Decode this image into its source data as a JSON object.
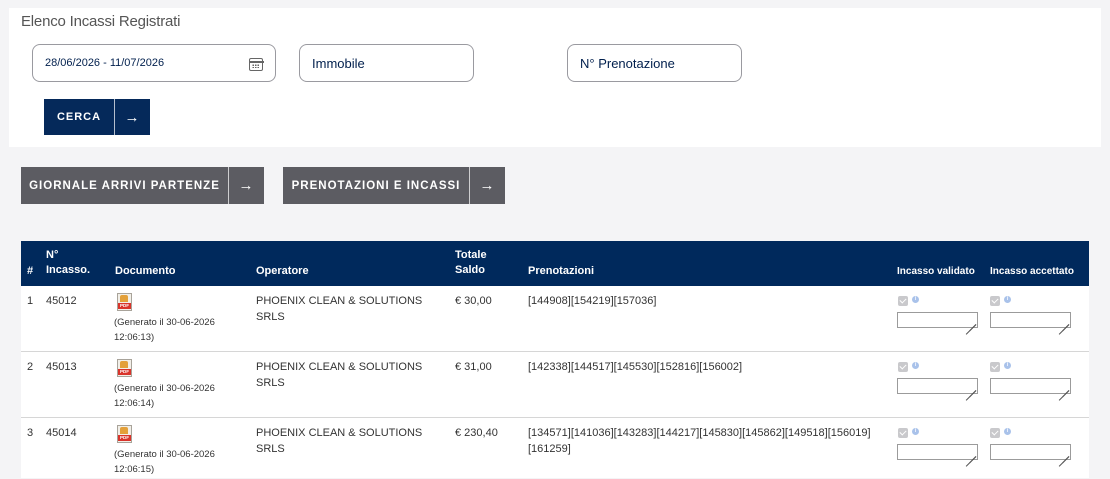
{
  "filters": {
    "panel_title": "Elenco Incassi Registrati",
    "date_range_value": "28/06/2026 - 11/07/2026",
    "immobile_placeholder": "Immobile",
    "prenotazione_placeholder": "N° Prenotazione",
    "search_label": "CERCA"
  },
  "actions": {
    "giornale_label": "GIORNALE ARRIVI PARTENZE",
    "prenotazioni_label": "PRENOTAZIONI E INCASSI"
  },
  "table": {
    "headers": {
      "index": "#",
      "incasso_line1": "N°",
      "incasso_line2": "Incasso.",
      "documento": "Documento",
      "operatore": "Operatore",
      "saldo_line1": "Totale",
      "saldo_line2": "Saldo",
      "prenotazioni": "Prenotazioni",
      "validato": "Incasso validato",
      "accettato": "Incasso accettato"
    },
    "rows": [
      {
        "index": "1",
        "incasso": "45012",
        "doc_tag": "PDF",
        "generated_line1": "(Generato il 30-06-2026",
        "generated_line2": "12:06:13)",
        "operator_line1": "PHOENIX CLEAN & SOLUTIONS",
        "operator_line2": "SRLS",
        "saldo": "€ 30,00",
        "prenotazioni_line1": "[144908][154219][157036]",
        "prenotazioni_line2": ""
      },
      {
        "index": "2",
        "incasso": "45013",
        "doc_tag": "PDF",
        "generated_line1": "(Generato il 30-06-2026",
        "generated_line2": "12:06:14)",
        "operator_line1": "PHOENIX CLEAN & SOLUTIONS",
        "operator_line2": "SRLS",
        "saldo": "€ 31,00",
        "prenotazioni_line1": "[142338][144517][145530][152816][156002]",
        "prenotazioni_line2": ""
      },
      {
        "index": "3",
        "incasso": "45014",
        "doc_tag": "PDF",
        "generated_line1": "(Generato il 30-06-2026",
        "generated_line2": "12:06:15)",
        "operator_line1": "PHOENIX CLEAN & SOLUTIONS",
        "operator_line2": "SRLS",
        "saldo": "€ 230,40",
        "prenotazioni_line1": "[134571][141036][143283][144217][145830][145862][149518][156019]",
        "prenotazioni_line2": "[161259]"
      }
    ]
  },
  "icons": {
    "calendar": "calendar-icon",
    "arrow": "→",
    "info": "i"
  },
  "colors": {
    "primary": "#05295a",
    "table_header": "#00295c",
    "secondary_button": "#5c5c62",
    "pdf_red": "#d9342b"
  }
}
